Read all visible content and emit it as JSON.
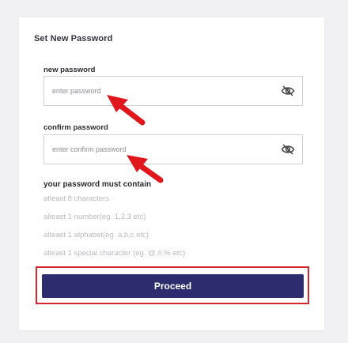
{
  "form": {
    "title": "Set New Password",
    "new_password": {
      "label": "new password",
      "placeholder": "enter password",
      "value": ""
    },
    "confirm_password": {
      "label": "confirm password",
      "placeholder": "enter confirm password",
      "value": ""
    },
    "requirements": {
      "title": "your password must contain",
      "items": [
        "atleast 8 characters",
        "alteast 1 number(eg. 1,2,3 etc)",
        "alteast 1 alphabet(eg. a,b,c etc)",
        "atleast 1 special character (eg. @,#,% etc)"
      ]
    },
    "proceed_label": "Proceed"
  },
  "icons": {
    "password_toggle": "eye-slash-icon",
    "annotation": "red-arrow-icon"
  },
  "colors": {
    "button_bg": "#2d2c6e",
    "highlight": "#d7262e",
    "arrow": "#e0181e"
  }
}
